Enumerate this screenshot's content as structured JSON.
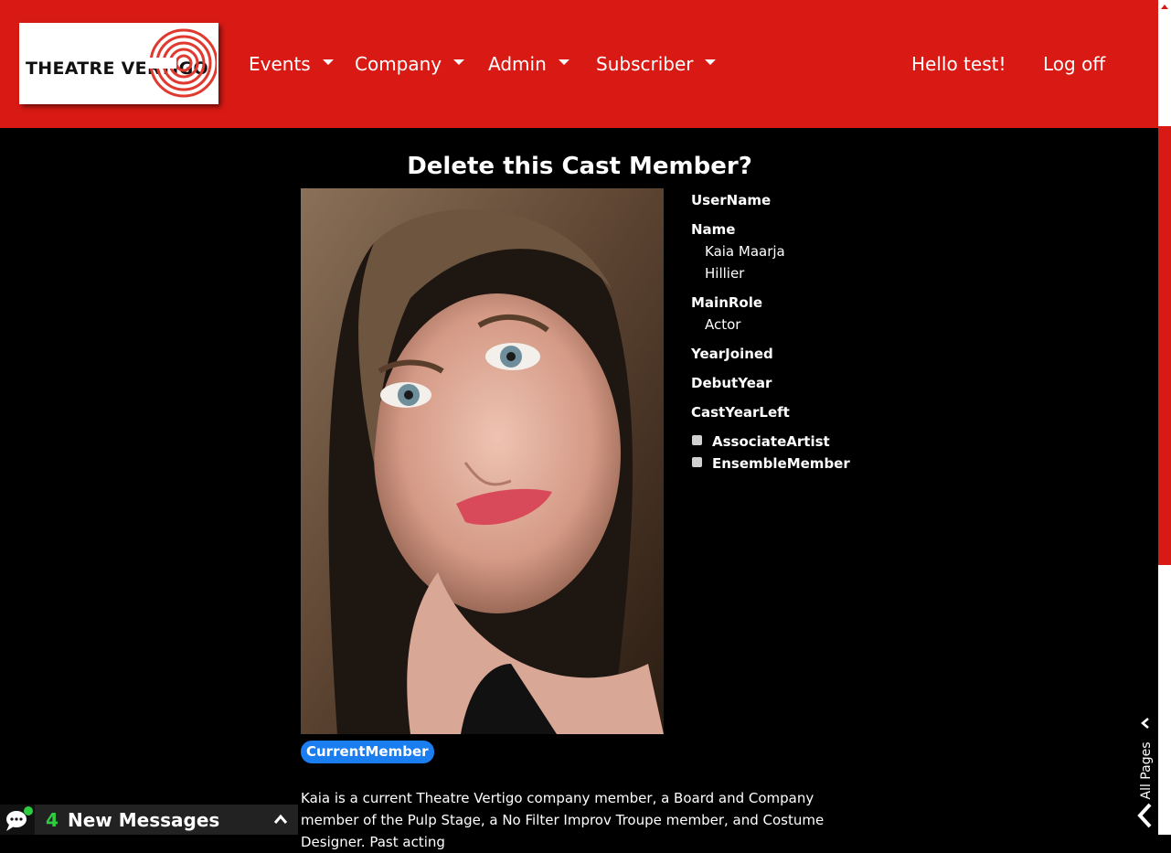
{
  "navbar": {
    "logo_text": "THEATRE VERTIGO",
    "menus": [
      {
        "label": "Events"
      },
      {
        "label": "Company"
      },
      {
        "label": "Admin"
      },
      {
        "label": "Subscriber"
      }
    ],
    "greeting": "Hello test!",
    "logoff": "Log off"
  },
  "page": {
    "title": "Delete this Cast Member?"
  },
  "details": {
    "username_label": "UserName",
    "name_label": "Name",
    "name_first": "Kaia Maarja",
    "name_last": "Hillier",
    "mainrole_label": "MainRole",
    "mainrole_value": "Actor",
    "yearjoined_label": "YearJoined",
    "debutyear_label": "DebutYear",
    "castyearleft_label": "CastYearLeft",
    "associate_label": "AssociateArtist",
    "ensemble_label": "EnsembleMember"
  },
  "badge": "CurrentMember",
  "bio": "Kaia is a current Theatre Vertigo company member, a Board and Company member of the Pulp Stage, a No Filter Improv Troupe member, and Costume Designer. Past acting",
  "messages": {
    "count": "4",
    "label": "New Messages"
  },
  "side_tab": {
    "label": "All Pages"
  },
  "colors": {
    "brand_red": "#d91a14",
    "badge_blue": "#1a7df0",
    "message_green": "#2ecc40"
  }
}
